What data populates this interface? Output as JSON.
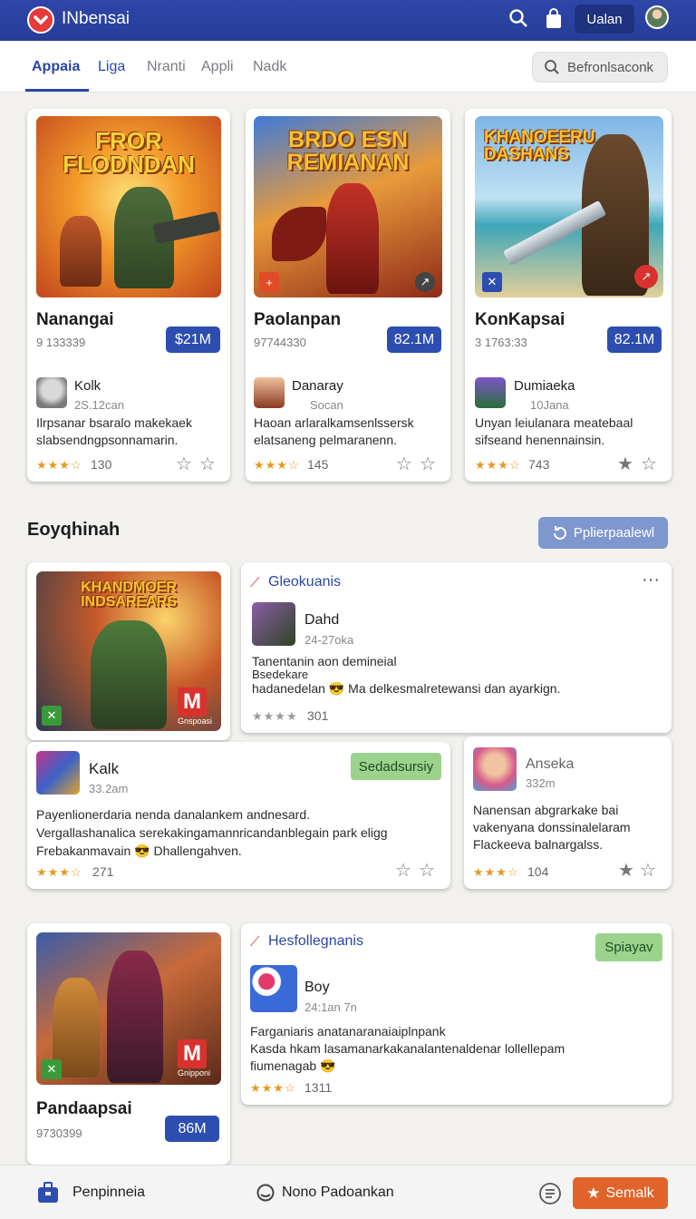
{
  "header": {
    "brand": "INbensai",
    "user_button": "Ualan"
  },
  "tabs": [
    "Appaia",
    "Liga",
    "Nranti",
    "Appli",
    "Nadk"
  ],
  "search": {
    "label": "Befronlsaconk"
  },
  "featured": [
    {
      "art_title_1": "FROR",
      "art_title_2": "FLODNDAN",
      "title": "Nanangai",
      "sub": "9 133339",
      "price": "$21M",
      "publisher": "Kolk",
      "pub_meta": "2S.12can",
      "desc_1": "Ilrpsanar bsaralo makekaek",
      "desc_2": "slabsendngpsonnamarin.",
      "stars": "★★★☆",
      "rating": "130"
    },
    {
      "art_title_1": "BRDO ESN",
      "art_title_2": "REMIANAN",
      "title": "Paolanpan",
      "sub": "97744330",
      "price": "82.1M",
      "publisher": "Danaray",
      "pub_meta": "Socan",
      "desc_1": "Haoan arlaralkamsenlssersk",
      "desc_2": "elatsaneng pelmaranenn.",
      "stars": "★★★☆",
      "rating": "145"
    },
    {
      "art_title_1": "KHANOEERU",
      "art_title_2": "DASHANS",
      "title": "KonKapsai",
      "sub": "3 1763:33",
      "price": "82.1M",
      "publisher": "Dumiaeka",
      "pub_meta": "10Jana",
      "desc_1": "Unyan leiulanara meatebaal",
      "desc_2": "sifseand henennainsin.",
      "stars": "★★★☆",
      "rating": "743"
    }
  ],
  "section2": {
    "title": "Eoyqhinah",
    "button": "Pplierpaalewl"
  },
  "post1": {
    "art_title_1": "KHANDMOER",
    "art_title_2": "INDSAREARS",
    "badge": "M",
    "badge_label": "Gnspoasi",
    "category": "Gleokuanis",
    "author": "Dahd",
    "meta": "24-27oka",
    "line1": "Tanentanin aon demineial",
    "line2": "Bsedekare",
    "line3": "hadanedelan 😎 Ma delkesmalretewansi dan ayarkign.",
    "stars": "★★★★",
    "rating": "301"
  },
  "post2": {
    "author": "Kalk",
    "meta": "33.2am",
    "tag": "Sedadsursiy",
    "line1": "Payenlionerdaria nenda danalankem andnesard.",
    "line2": "Vergallashanalica serekakingamannricandanblegain park eligg",
    "line3": "Frebakanmavain 😎 Dhallengahven.",
    "stars": "★★★☆",
    "rating": "271"
  },
  "post3": {
    "author": "Anseka",
    "meta": "332m",
    "line1": "Nanensan abgrarkake bai",
    "line2": "vakenyana donssinalelaram",
    "line3": "Flackeeva balnargalss.",
    "stars": "★★★☆",
    "rating": "104"
  },
  "post4": {
    "title": "Pandaapsai",
    "sub": "9730399",
    "price": "86M",
    "badge": "M",
    "badge_label": "Gnipponi"
  },
  "post5": {
    "category": "Hesfollegnanis",
    "tag": "Spiayav",
    "author": "Boy",
    "meta": "24:1an 7n",
    "line1": "Farganiaris anatanaranaiaiplnpank",
    "line2": "Kasda hkam lasamanarkakanalantenaldenar lollellepam",
    "line3": "fiumenagab 😎",
    "stars": "★★★☆",
    "rating": "1311"
  },
  "bottom": {
    "left": "Penpinneia",
    "center": "Nono Padoankan",
    "right": "Semalk"
  },
  "colors": {
    "primary": "#2d4eb0",
    "accent": "#e0642a",
    "green": "#9bd38d"
  }
}
